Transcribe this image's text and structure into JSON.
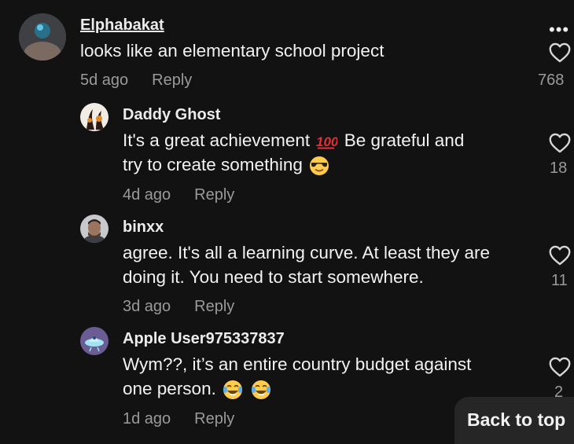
{
  "comments": [
    {
      "username": "Elphabakat",
      "text_lines": [
        "looks like an elementary school project"
      ],
      "time": "5d ago",
      "reply_label": "Reply",
      "likes": "768"
    },
    {
      "username": "Daddy Ghost",
      "text_lines": [
        "It's a great achievement",
        "Be grateful and",
        "try to create something"
      ],
      "time": "4d ago",
      "reply_label": "Reply",
      "likes": "18"
    },
    {
      "username": "binxx",
      "text_lines": [
        "agree. It's all a learning curve. At least they are",
        "doing it. You need to start somewhere."
      ],
      "time": "3d ago",
      "reply_label": "Reply",
      "likes": "11"
    },
    {
      "username": "Apple User975337837",
      "text_lines": [
        "Wym??, it’s an entire country budget against",
        "one person."
      ],
      "time": "1d ago",
      "reply_label": "Reply",
      "likes": "2"
    }
  ],
  "more_options_label": "•••",
  "back_to_top_label": "Back to top",
  "icons": {
    "hundred": "hundred-points-emoji",
    "cool": "smiling-face-with-sunglasses-emoji",
    "laugh": "face-with-tears-of-joy-emoji",
    "heart": "heart-outline-icon"
  },
  "colors": {
    "background": "#121212",
    "text": "#f2f2f2",
    "muted": "#9a9a9a"
  }
}
